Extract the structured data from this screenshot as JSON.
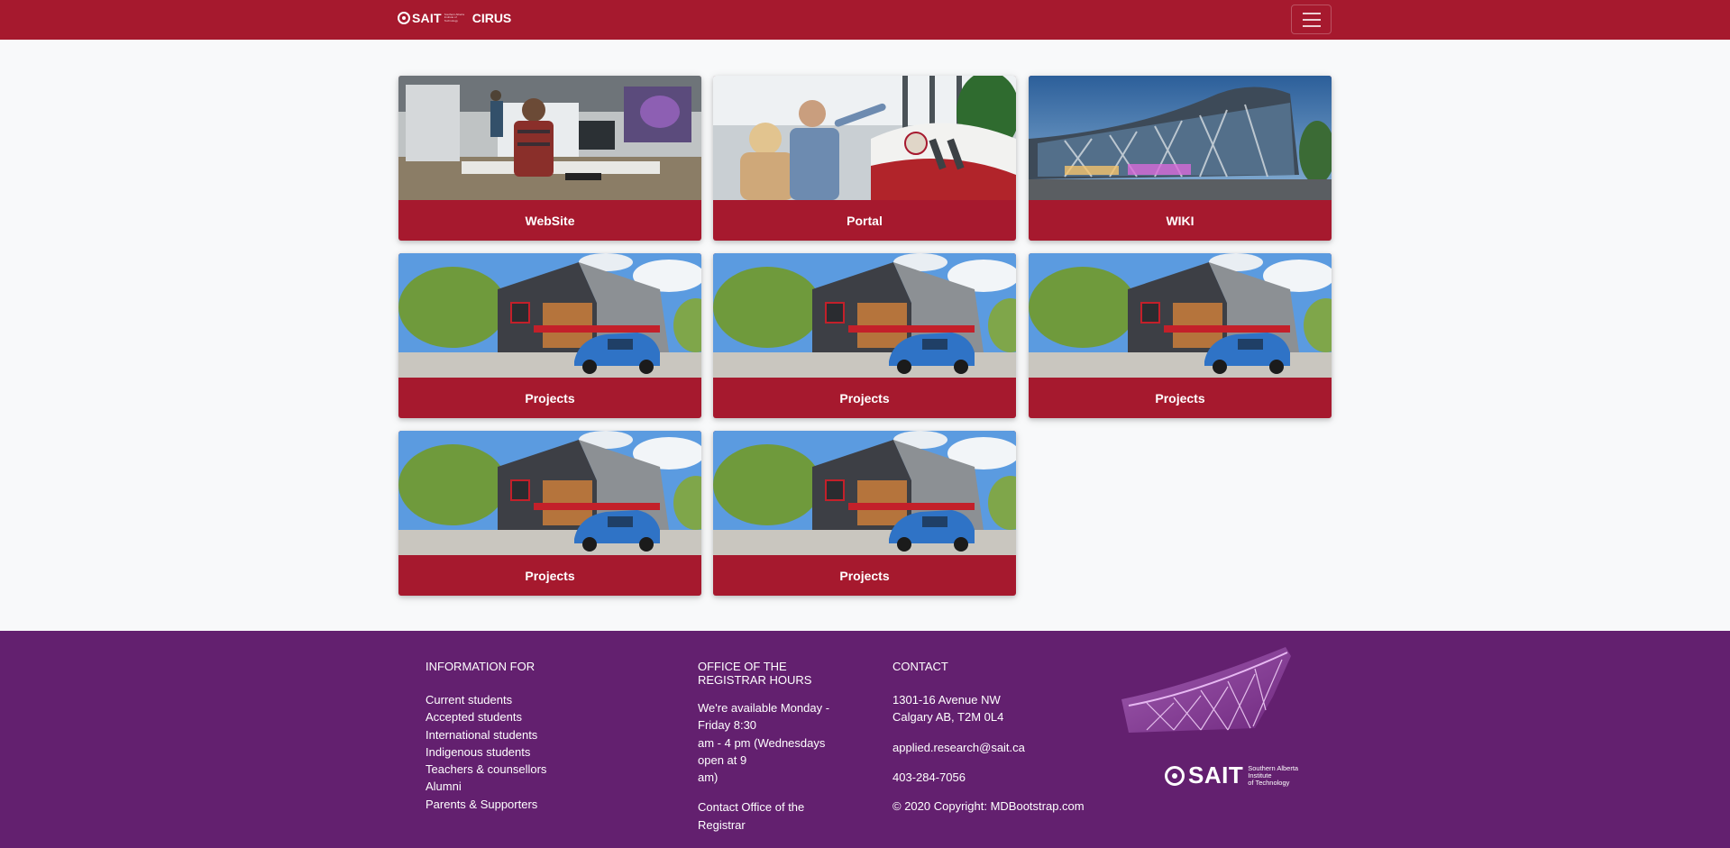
{
  "navbar": {
    "brand_sait": "SAIT",
    "brand_sub": "Southern Alberta Institute of Technology",
    "brand_app": "CIRUS",
    "toggler": "hamburger-icon"
  },
  "cards": [
    {
      "label": "WebSite",
      "image": "lab-workstation-photo"
    },
    {
      "label": "Portal",
      "image": "aircraft-model-photo"
    },
    {
      "label": "WIKI",
      "image": "campus-building-photo"
    },
    {
      "label": "Projects",
      "image": "house-with-blue-car-photo"
    },
    {
      "label": "Projects",
      "image": "house-with-blue-car-photo"
    },
    {
      "label": "Projects",
      "image": "house-with-blue-car-photo"
    },
    {
      "label": "Projects",
      "image": "house-with-blue-car-photo"
    },
    {
      "label": "Projects",
      "image": "house-with-blue-car-photo"
    }
  ],
  "footer": {
    "info": {
      "heading": "INFORMATION FOR",
      "links": [
        "Current students",
        "Accepted students",
        "International students",
        "Indigenous students",
        "Teachers & counsellors",
        "Alumni",
        "Parents & Supporters"
      ]
    },
    "registrar": {
      "heading1": "OFFICE OF THE",
      "heading2": "REGISTRAR HOURS",
      "lines": [
        "We're available Monday -",
        "Friday 8:30",
        "am - 4 pm (Wednesdays",
        "open at 9",
        "am)"
      ],
      "link1": "Contact Office of the",
      "link2": "Registrar"
    },
    "contact": {
      "heading": "CONTACT",
      "address1": "1301-16 Avenue NW",
      "address2": "Calgary AB, T2M 0L4",
      "email": "applied.research@sait.ca",
      "phone": "403-284-7056",
      "copyright": "© 2020 Copyright: MDBootstrap.com"
    },
    "logo": {
      "name": "SAIT",
      "sub1": "Southern Alberta",
      "sub2": "Institute",
      "sub3": "of Technology"
    }
  },
  "colors": {
    "brand_red": "#a6192e",
    "footer_purple": "#63206f",
    "page_bg": "#f8f9fa"
  }
}
